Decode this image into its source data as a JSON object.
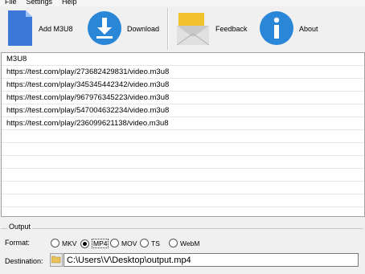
{
  "menu": [
    "File",
    "Settings",
    "Help"
  ],
  "toolbar": {
    "add_label": "Add M3U8",
    "download_label": "Download",
    "feedback_label": "Feedback",
    "about_label": "About"
  },
  "list": {
    "header": "M3U8",
    "urls": [
      "https://test.com/play/273682429831/video.m3u8",
      "https://test.com/play/345345442342/video.m3u8",
      "https://test.com/play/967976345223/video.m3u8",
      "https://test.com/play/547004632234/video.m3u8",
      "https://test.com/play/236099621138/video.m3u8"
    ]
  },
  "output": {
    "title": "Output",
    "format_label": "Format:",
    "formats": [
      "MKV",
      "MP4",
      "MOV",
      "TS",
      "WebM"
    ],
    "selected_format": "MP4",
    "destination_label": "Destination:",
    "destination_value": "C:\\Users\\V\\Desktop\\output.mp4"
  },
  "colors": {
    "doc_icon": "#3b78d8",
    "download_icon": "#2a86d6",
    "feedback_envelope": "#f2c12e",
    "about_icon": "#2a86d6",
    "folder": "#e8c15a"
  }
}
